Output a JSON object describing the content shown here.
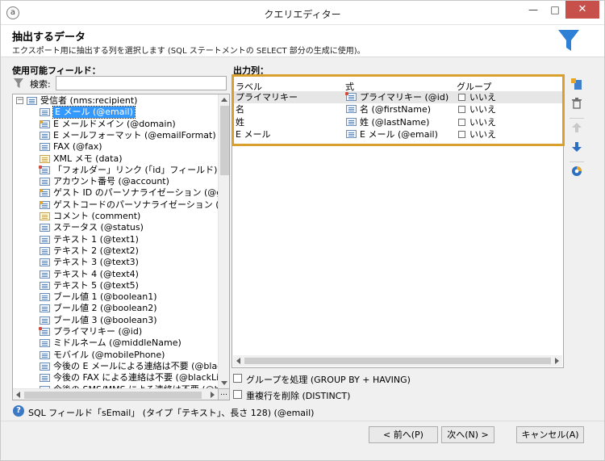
{
  "window": {
    "title": "クエリエディター",
    "min_glyph": "—",
    "max_glyph": "□",
    "close_glyph": "✕"
  },
  "header": {
    "title": "抽出するデータ",
    "description": "エクスポート用に抽出する列を選択します (SQL ステートメントの SELECT 部分の生成に使用)。"
  },
  "fields_panel": {
    "label": "使用可能フィールド：",
    "filter_label": "検索:",
    "filter_value": "",
    "root": "受信者 (nms:recipient)",
    "items": [
      {
        "label": "E メール (@email)",
        "icon": "field-icon",
        "selected": true
      },
      {
        "label": "E メールドメイン (@domain)",
        "icon": "link-field-icon"
      },
      {
        "label": "E メールフォーマット (@emailFormat)",
        "icon": "field-icon"
      },
      {
        "label": "FAX (@fax)",
        "icon": "field-icon"
      },
      {
        "label": "XML メモ (data)",
        "icon": "memo-icon"
      },
      {
        "label": "「フォルダー」リンク (「id」フィールド) の外部キー (@",
        "icon": "key-field-icon"
      },
      {
        "label": "アカウント番号 (@account)",
        "icon": "field-icon"
      },
      {
        "label": "ゲスト ID のパーソナライゼーション (@guestIdE",
        "icon": "link-field-icon"
      },
      {
        "label": "ゲストコードのパーソナライゼーション (@guestCo",
        "icon": "link-field-icon"
      },
      {
        "label": "コメント (comment)",
        "icon": "memo-icon"
      },
      {
        "label": "ステータス (@status)",
        "icon": "field-icon"
      },
      {
        "label": "テキスト 1 (@text1)",
        "icon": "field-icon"
      },
      {
        "label": "テキスト 2 (@text2)",
        "icon": "field-icon"
      },
      {
        "label": "テキスト 3 (@text3)",
        "icon": "field-icon"
      },
      {
        "label": "テキスト 4 (@text4)",
        "icon": "field-icon"
      },
      {
        "label": "テキスト 5 (@text5)",
        "icon": "field-icon"
      },
      {
        "label": "ブール値 1 (@boolean1)",
        "icon": "field-icon"
      },
      {
        "label": "ブール値 2 (@boolean2)",
        "icon": "field-icon"
      },
      {
        "label": "ブール値 3 (@boolean3)",
        "icon": "field-icon"
      },
      {
        "label": "プライマリキー (@id)",
        "icon": "key-field-icon"
      },
      {
        "label": "ミドルネーム (@middleName)",
        "icon": "field-icon"
      },
      {
        "label": "モバイル (@mobilePhone)",
        "icon": "field-icon"
      },
      {
        "label": "今後の E メールによる連絡は不要 (@blackLis",
        "icon": "field-icon"
      },
      {
        "label": "今後の FAX による連絡は不要 (@blackListFa",
        "icon": "field-icon"
      },
      {
        "label": "今後の SMS/MMS による連絡は不要 (@blac",
        "icon": "field-icon"
      }
    ],
    "more_label": "…"
  },
  "output_panel": {
    "label": "出力列：",
    "columns": [
      "ラベル",
      "式",
      "グループ"
    ],
    "rows": [
      {
        "label": "プライマリキー",
        "expr": "プライマリキー (@id)",
        "group": "いいえ",
        "icon": "key-field-icon",
        "selected": true
      },
      {
        "label": "名",
        "expr": "名 (@firstName)",
        "group": "いいえ",
        "icon": "field-icon"
      },
      {
        "label": "姓",
        "expr": "姓 (@lastName)",
        "group": "いいえ",
        "icon": "field-icon"
      },
      {
        "label": "E メール",
        "expr": "E メール (@email)",
        "group": "いいえ",
        "icon": "field-icon"
      }
    ],
    "toolbar": [
      "add-column-icon",
      "delete-icon",
      "move-up-icon",
      "move-down-icon",
      "distribution-icon"
    ],
    "group_by_label": "グループを処理 (GROUP BY + HAVING)",
    "group_by_checked": false,
    "distinct_label": "重複行を削除 (DISTINCT)",
    "distinct_checked": false
  },
  "status": {
    "text": "SQL フィールド「sEmail」 (タイプ「テキスト」、長さ 128) (@email)"
  },
  "buttons": {
    "prev": "< 前へ(P)",
    "next": "次へ(N) >",
    "cancel": "キャンセル(A)"
  },
  "colors": {
    "selection": "#3399ff",
    "highlight_border": "#d9a02e",
    "funnel": "#2e7fd6",
    "close_button": "#c7504b"
  }
}
